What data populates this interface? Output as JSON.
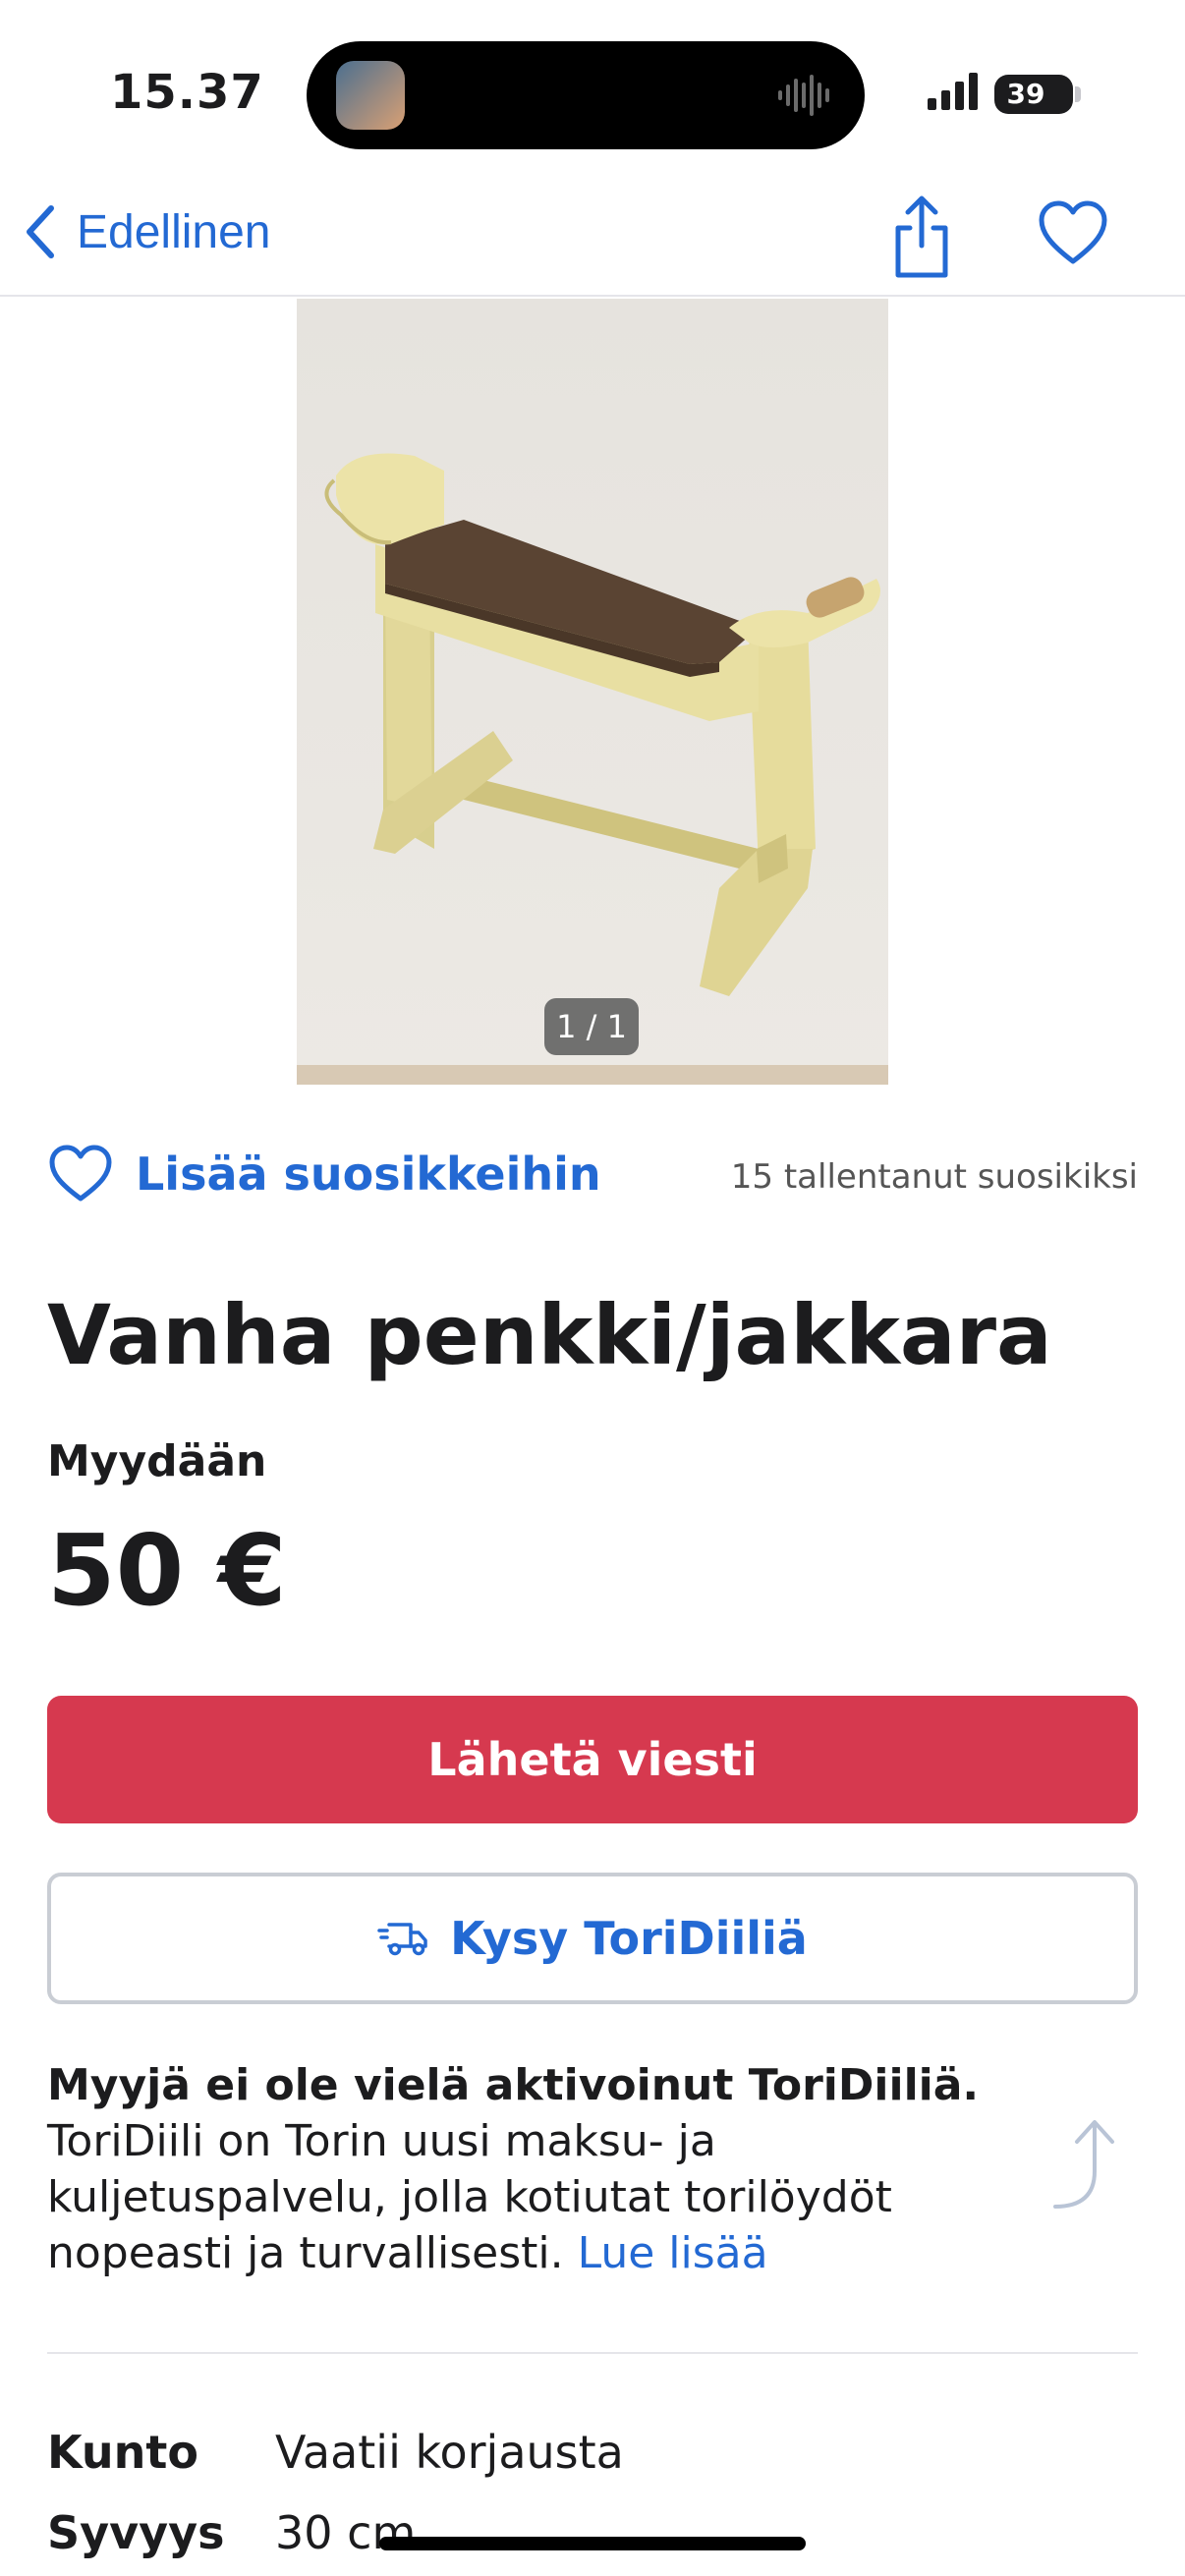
{
  "status_bar": {
    "time": "15.37",
    "battery": "39"
  },
  "nav": {
    "back_label": "Edellinen",
    "icons": [
      "chevron-left-icon",
      "share-icon",
      "heart-outline-icon"
    ]
  },
  "photo": {
    "counter": "1 / 1"
  },
  "favorites": {
    "label": "Lisää suosikkeihin",
    "count_text": "15 tallentanut suosikiksi"
  },
  "listing": {
    "title": "Vanha penkki/jakkara",
    "sale_type": "Myydään",
    "price": "50 €"
  },
  "actions": {
    "send_message": "Lähetä viesti",
    "ask_deal": "Kysy ToriDiiliä"
  },
  "info": {
    "bold": "Myyjä ei ole vielä aktivoinut ToriDiiliä.",
    "text": "ToriDiili on Torin uusi maksu- ja kuljetuspalvelu, jolla kotiutat torilöydöt nopeasti ja turvallisesti.",
    "link": "Lue lisää"
  },
  "specs": [
    {
      "label": "Kunto",
      "value": "Vaatii korjausta"
    },
    {
      "label": "Syvyys",
      "value": "30 cm"
    }
  ],
  "colors": {
    "accent_blue": "#2369d3",
    "primary_red": "#d6394f",
    "border_gray": "#c9cdd4"
  }
}
